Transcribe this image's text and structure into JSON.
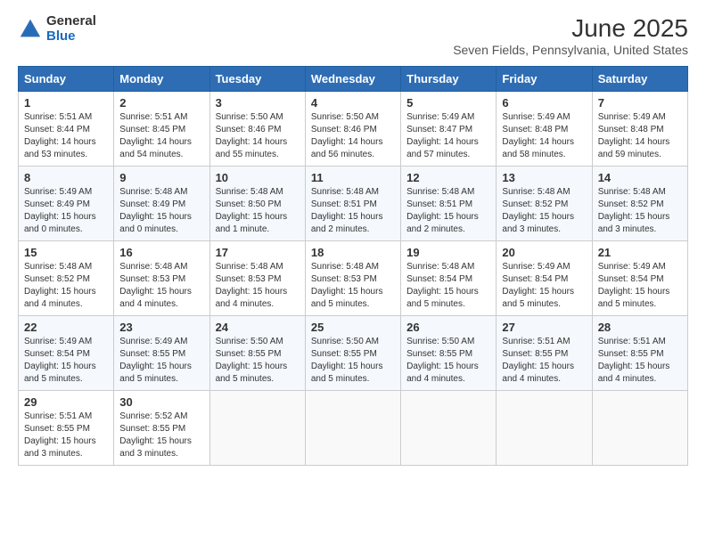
{
  "logo": {
    "general": "General",
    "blue": "Blue"
  },
  "title": "June 2025",
  "subtitle": "Seven Fields, Pennsylvania, United States",
  "days_of_week": [
    "Sunday",
    "Monday",
    "Tuesday",
    "Wednesday",
    "Thursday",
    "Friday",
    "Saturday"
  ],
  "weeks": [
    [
      {
        "day": "1",
        "sunrise": "5:51 AM",
        "sunset": "8:44 PM",
        "daylight": "14 hours and 53 minutes."
      },
      {
        "day": "2",
        "sunrise": "5:51 AM",
        "sunset": "8:45 PM",
        "daylight": "14 hours and 54 minutes."
      },
      {
        "day": "3",
        "sunrise": "5:50 AM",
        "sunset": "8:46 PM",
        "daylight": "14 hours and 55 minutes."
      },
      {
        "day": "4",
        "sunrise": "5:50 AM",
        "sunset": "8:46 PM",
        "daylight": "14 hours and 56 minutes."
      },
      {
        "day": "5",
        "sunrise": "5:49 AM",
        "sunset": "8:47 PM",
        "daylight": "14 hours and 57 minutes."
      },
      {
        "day": "6",
        "sunrise": "5:49 AM",
        "sunset": "8:48 PM",
        "daylight": "14 hours and 58 minutes."
      },
      {
        "day": "7",
        "sunrise": "5:49 AM",
        "sunset": "8:48 PM",
        "daylight": "14 hours and 59 minutes."
      }
    ],
    [
      {
        "day": "8",
        "sunrise": "5:49 AM",
        "sunset": "8:49 PM",
        "daylight": "15 hours and 0 minutes."
      },
      {
        "day": "9",
        "sunrise": "5:48 AM",
        "sunset": "8:49 PM",
        "daylight": "15 hours and 0 minutes."
      },
      {
        "day": "10",
        "sunrise": "5:48 AM",
        "sunset": "8:50 PM",
        "daylight": "15 hours and 1 minute."
      },
      {
        "day": "11",
        "sunrise": "5:48 AM",
        "sunset": "8:51 PM",
        "daylight": "15 hours and 2 minutes."
      },
      {
        "day": "12",
        "sunrise": "5:48 AM",
        "sunset": "8:51 PM",
        "daylight": "15 hours and 2 minutes."
      },
      {
        "day": "13",
        "sunrise": "5:48 AM",
        "sunset": "8:52 PM",
        "daylight": "15 hours and 3 minutes."
      },
      {
        "day": "14",
        "sunrise": "5:48 AM",
        "sunset": "8:52 PM",
        "daylight": "15 hours and 3 minutes."
      }
    ],
    [
      {
        "day": "15",
        "sunrise": "5:48 AM",
        "sunset": "8:52 PM",
        "daylight": "15 hours and 4 minutes."
      },
      {
        "day": "16",
        "sunrise": "5:48 AM",
        "sunset": "8:53 PM",
        "daylight": "15 hours and 4 minutes."
      },
      {
        "day": "17",
        "sunrise": "5:48 AM",
        "sunset": "8:53 PM",
        "daylight": "15 hours and 4 minutes."
      },
      {
        "day": "18",
        "sunrise": "5:48 AM",
        "sunset": "8:53 PM",
        "daylight": "15 hours and 5 minutes."
      },
      {
        "day": "19",
        "sunrise": "5:48 AM",
        "sunset": "8:54 PM",
        "daylight": "15 hours and 5 minutes."
      },
      {
        "day": "20",
        "sunrise": "5:49 AM",
        "sunset": "8:54 PM",
        "daylight": "15 hours and 5 minutes."
      },
      {
        "day": "21",
        "sunrise": "5:49 AM",
        "sunset": "8:54 PM",
        "daylight": "15 hours and 5 minutes."
      }
    ],
    [
      {
        "day": "22",
        "sunrise": "5:49 AM",
        "sunset": "8:54 PM",
        "daylight": "15 hours and 5 minutes."
      },
      {
        "day": "23",
        "sunrise": "5:49 AM",
        "sunset": "8:55 PM",
        "daylight": "15 hours and 5 minutes."
      },
      {
        "day": "24",
        "sunrise": "5:50 AM",
        "sunset": "8:55 PM",
        "daylight": "15 hours and 5 minutes."
      },
      {
        "day": "25",
        "sunrise": "5:50 AM",
        "sunset": "8:55 PM",
        "daylight": "15 hours and 5 minutes."
      },
      {
        "day": "26",
        "sunrise": "5:50 AM",
        "sunset": "8:55 PM",
        "daylight": "15 hours and 4 minutes."
      },
      {
        "day": "27",
        "sunrise": "5:51 AM",
        "sunset": "8:55 PM",
        "daylight": "15 hours and 4 minutes."
      },
      {
        "day": "28",
        "sunrise": "5:51 AM",
        "sunset": "8:55 PM",
        "daylight": "15 hours and 4 minutes."
      }
    ],
    [
      {
        "day": "29",
        "sunrise": "5:51 AM",
        "sunset": "8:55 PM",
        "daylight": "15 hours and 3 minutes."
      },
      {
        "day": "30",
        "sunrise": "5:52 AM",
        "sunset": "8:55 PM",
        "daylight": "15 hours and 3 minutes."
      },
      null,
      null,
      null,
      null,
      null
    ]
  ]
}
